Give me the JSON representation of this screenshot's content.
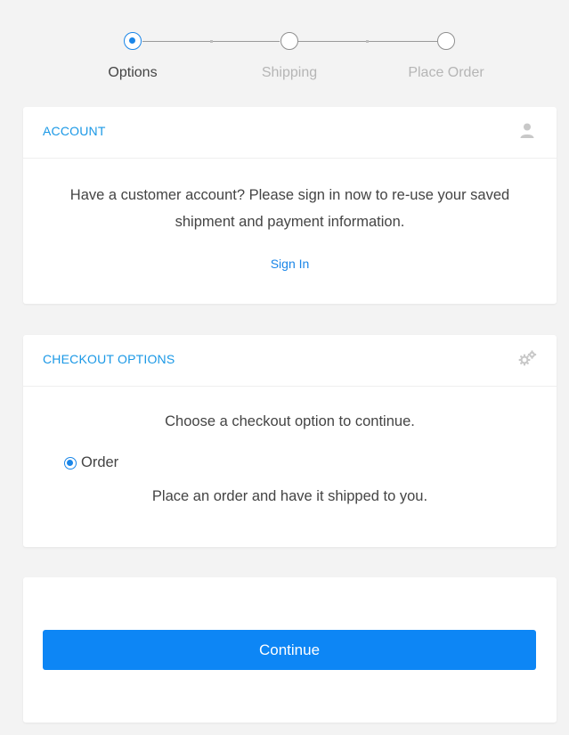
{
  "stepper": {
    "steps": [
      {
        "label": "Options",
        "active": true
      },
      {
        "label": "Shipping",
        "active": false
      },
      {
        "label": "Place Order",
        "active": false
      }
    ]
  },
  "account": {
    "title": "ACCOUNT",
    "icon": "user-icon",
    "line1": "Have a customer account? Please sign in now to re-use your saved",
    "line2": "shipment and payment information.",
    "signin_label": "Sign In"
  },
  "checkout": {
    "title": "CHECKOUT OPTIONS",
    "icon": "settings-gears-icon",
    "prompt": "Choose a checkout option to continue.",
    "option_label": "Order",
    "option_selected": true,
    "option_description": "Place an order and have it shipped to you."
  },
  "actions": {
    "continue_label": "Continue"
  },
  "colors": {
    "accent": "#1a86e8",
    "button": "#0d86f5",
    "background": "#f3f3f3",
    "card": "#ffffff",
    "muted_text": "#b5b5b5"
  }
}
